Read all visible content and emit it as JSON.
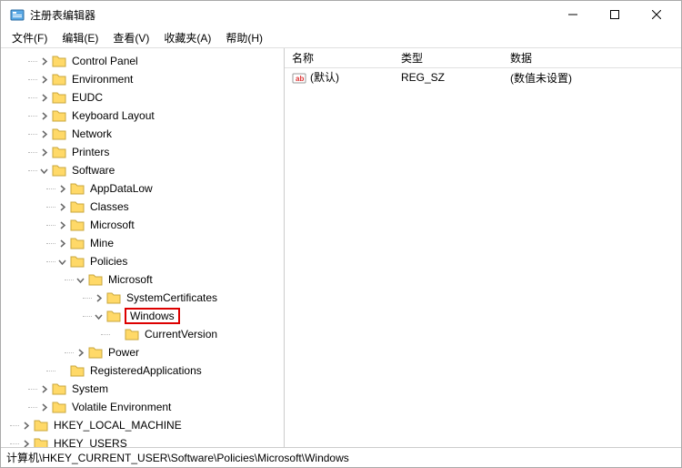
{
  "window": {
    "title": "注册表编辑器"
  },
  "menu": {
    "file": "文件(F)",
    "edit": "编辑(E)",
    "view": "查看(V)",
    "favorites": "收藏夹(A)",
    "help": "帮助(H)"
  },
  "tree": {
    "nodes": [
      {
        "indent": 40,
        "expander": "right",
        "label": "Control Panel"
      },
      {
        "indent": 40,
        "expander": "right",
        "label": "Environment"
      },
      {
        "indent": 40,
        "expander": "right",
        "label": "EUDC"
      },
      {
        "indent": 40,
        "expander": "right",
        "label": "Keyboard Layout"
      },
      {
        "indent": 40,
        "expander": "right",
        "label": "Network"
      },
      {
        "indent": 40,
        "expander": "right",
        "label": "Printers"
      },
      {
        "indent": 40,
        "expander": "down",
        "label": "Software"
      },
      {
        "indent": 60,
        "expander": "right",
        "label": "AppDataLow"
      },
      {
        "indent": 60,
        "expander": "right",
        "label": "Classes"
      },
      {
        "indent": 60,
        "expander": "right",
        "label": "Microsoft"
      },
      {
        "indent": 60,
        "expander": "right",
        "label": "Mine"
      },
      {
        "indent": 60,
        "expander": "down",
        "label": "Policies"
      },
      {
        "indent": 80,
        "expander": "down",
        "label": "Microsoft"
      },
      {
        "indent": 100,
        "expander": "right",
        "label": "SystemCertificates"
      },
      {
        "indent": 100,
        "expander": "down",
        "label": "Windows",
        "selected": true
      },
      {
        "indent": 120,
        "expander": "none",
        "label": "CurrentVersion"
      },
      {
        "indent": 80,
        "expander": "right",
        "label": "Power"
      },
      {
        "indent": 60,
        "expander": "none",
        "label": "RegisteredApplications"
      },
      {
        "indent": 40,
        "expander": "right",
        "label": "System"
      },
      {
        "indent": 40,
        "expander": "right",
        "label": "Volatile Environment"
      },
      {
        "indent": 20,
        "expander": "right",
        "label": "HKEY_LOCAL_MACHINE"
      },
      {
        "indent": 20,
        "expander": "right",
        "label": "HKEY_USERS"
      }
    ]
  },
  "list": {
    "columns": {
      "name": "名称",
      "type": "类型",
      "data": "数据"
    },
    "rows": [
      {
        "name": "(默认)",
        "type": "REG_SZ",
        "data": "(数值未设置)"
      }
    ]
  },
  "statusbar": {
    "path": "计算机\\HKEY_CURRENT_USER\\Software\\Policies\\Microsoft\\Windows"
  }
}
